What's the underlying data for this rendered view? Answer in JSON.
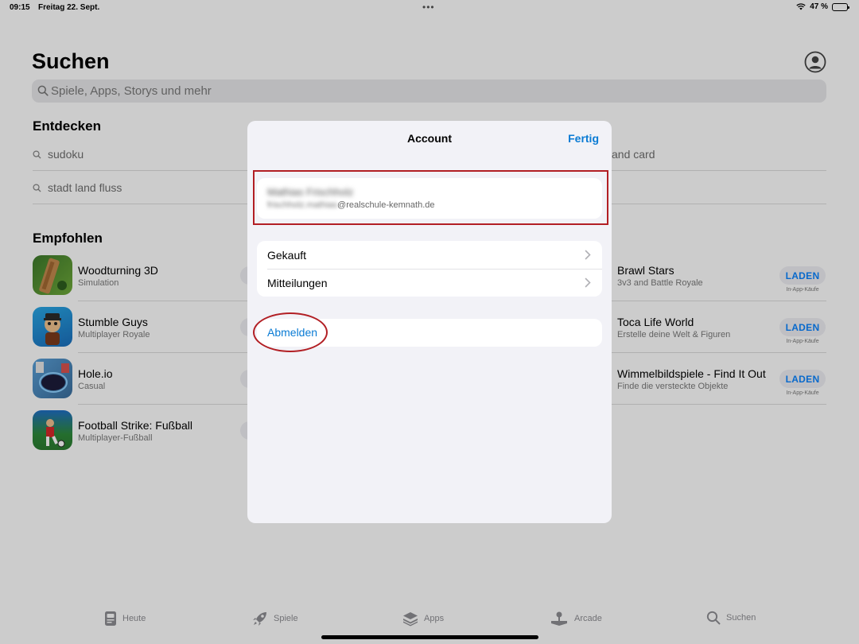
{
  "status": {
    "time": "09:15",
    "date": "Freitag 22. Sept.",
    "battery": "47 %",
    "battery_level": 0.47
  },
  "page": {
    "title": "Suchen"
  },
  "search": {
    "placeholder": "Spiele, Apps, Storys und mehr"
  },
  "discover": {
    "title": "Entdecken",
    "items": [
      {
        "label": "sudoku"
      },
      {
        "label": "stadt land fluss"
      },
      {
        "label": "and card"
      }
    ]
  },
  "recommended": {
    "title": "Empfohlen",
    "apps": [
      {
        "name": "Woodturning 3D",
        "subtitle": "Simulation"
      },
      {
        "name": "Stumble Guys",
        "subtitle": "Multiplayer Royale"
      },
      {
        "name": "Hole.io",
        "subtitle": "Casual"
      },
      {
        "name": "Football Strike: Fußball",
        "subtitle": "Multiplayer-Fußball"
      },
      {
        "name": "Brawl Stars",
        "subtitle": "3v3 and Battle Royale",
        "button": "LADEN",
        "note": "In-App-Käufe"
      },
      {
        "name": "Toca Life World",
        "subtitle": "Erstelle deine Welt & Figuren",
        "button": "LADEN",
        "note": "In-App-Käufe"
      },
      {
        "name": "Wimmelbildspiele - Find It Out",
        "subtitle": "Finde die versteckte Objekte",
        "button": "LADEN",
        "note": "In-App-Käufe"
      }
    ]
  },
  "tabs": [
    {
      "label": "Heute",
      "icon": "today-icon"
    },
    {
      "label": "Spiele",
      "icon": "rocket-icon"
    },
    {
      "label": "Apps",
      "icon": "layers-icon"
    },
    {
      "label": "Arcade",
      "icon": "joystick-icon"
    },
    {
      "label": "Suchen",
      "icon": "search-icon"
    }
  ],
  "modal": {
    "title": "Account",
    "done": "Fertig",
    "account": {
      "name": "Mathias Frischholz",
      "email_hidden": "frischholz.mathias",
      "email_domain": "@realschule-kemnath.de"
    },
    "menu": [
      {
        "label": "Gekauft"
      },
      {
        "label": "Mitteilungen"
      }
    ],
    "logout": "Abmelden"
  },
  "colors": {
    "accent": "#0a7bd4",
    "highlight": "#b21f24"
  }
}
